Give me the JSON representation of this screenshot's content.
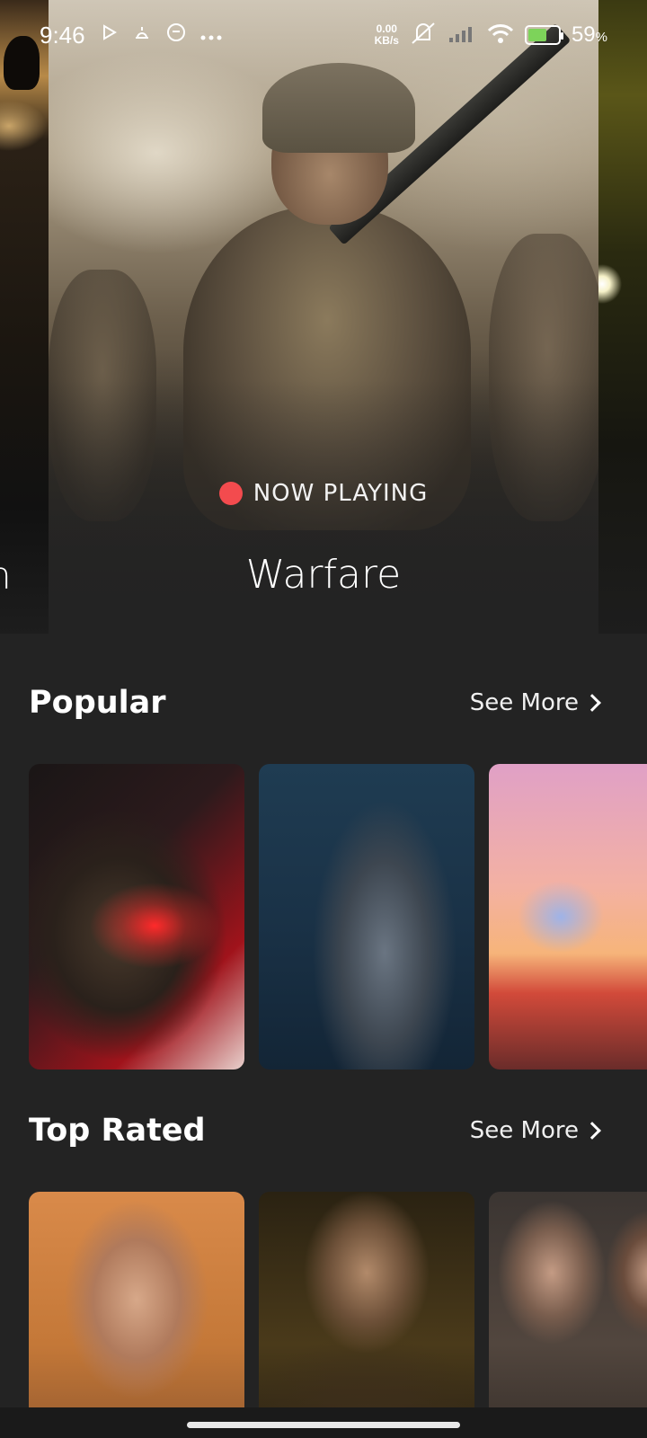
{
  "status_bar": {
    "time": "9:46",
    "net_speed_value": "0.00",
    "net_speed_unit": "KB/s",
    "battery_value": "59",
    "battery_unit": "%"
  },
  "hero": {
    "prev_title_fragment": "n",
    "badge_label": "NOW PLAYING",
    "badge_color": "#f34b4e",
    "title": "Warfare"
  },
  "sections": {
    "popular": {
      "title": "Popular",
      "see_more": "See More"
    },
    "top_rated": {
      "title": "Top Rated",
      "see_more": "See More"
    }
  },
  "colors": {
    "background": "#232323",
    "text": "#ffffff"
  }
}
